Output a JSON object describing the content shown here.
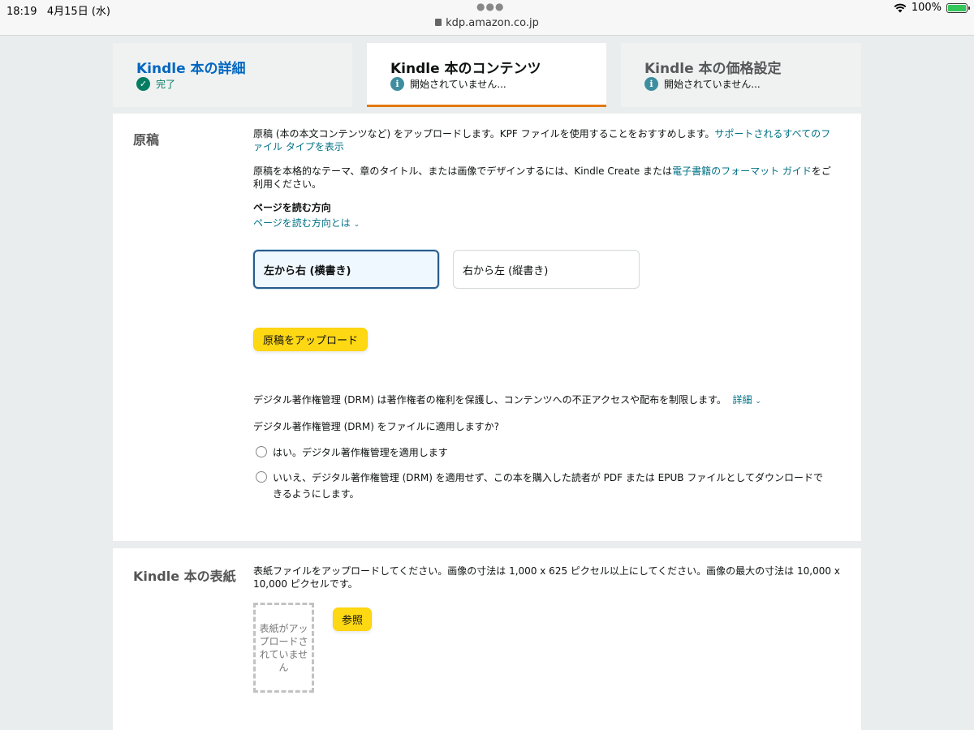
{
  "status_bar": {
    "time": "18:19",
    "date": "4月15日 (水)",
    "url": "kdp.amazon.co.jp",
    "battery": "100%"
  },
  "tabs": [
    {
      "title": "Kindle 本の詳細",
      "status": "完了",
      "state": "complete",
      "title_color": "#0066c0"
    },
    {
      "title": "Kindle 本のコンテンツ",
      "status": "開始されていません...",
      "state": "active",
      "title_color": "#0f1111"
    },
    {
      "title": "Kindle 本の価格設定",
      "status": "開始されていません...",
      "state": "not-started",
      "title_color": "#565959"
    }
  ],
  "manuscript": {
    "title": "原稿",
    "intro": "原稿 (本の本文コンテンツなど) をアップロードします。KPF ファイルを使用することをおすすめします。",
    "intro_link": "サポートされるすべてのファイル タイプを表示",
    "design_text_1": "原稿を本格的なテーマ、章のタイトル、または画像でデザインするには、Kindle Create または",
    "design_link": "電子書籍のフォーマット ガイド",
    "design_text_2": "をご利用ください。",
    "reading_direction_label": "ページを読む方向",
    "reading_direction_help": "ページを読む方向とは",
    "option_ltr": "左から右 (横書き)",
    "option_rtl": "右から左 (縦書き)",
    "selected_direction": "ltr",
    "upload_button": "原稿をアップロード",
    "drm_description": "デジタル著作権管理 (DRM) は著作権者の権利を保護し、コンテンツへの不正アクセスや配布を制限します。",
    "drm_details_link": "詳細",
    "drm_question": "デジタル著作権管理 (DRM) をファイルに適用しますか?",
    "drm_yes": "はい。デジタル著作権管理を適用します",
    "drm_no_line1": "いいえ、デジタル著作権管理 (DRM) を適用せず、この本を購入した読者が PDF または EPUB ファイルとしてダウンロードで",
    "drm_no_line2": "きるようにします。"
  },
  "cover": {
    "title": "Kindle 本の表紙",
    "instructions_line1": "表紙ファイルをアップロードしてください。画像の寸法は 1,000 x 625 ピクセル以上にしてください。画像の最大の寸法は 10,000 x",
    "instructions_line2": "10,000 ピクセルです。",
    "placeholder_text": "表紙がアップロードされていません",
    "browse_button": "参照"
  },
  "colors": {
    "accent_orange": "#e47911",
    "link_teal": "#007185",
    "button_yellow": "#ffd814",
    "complete_green": "#067d62",
    "info_teal": "#3f8ea0"
  }
}
